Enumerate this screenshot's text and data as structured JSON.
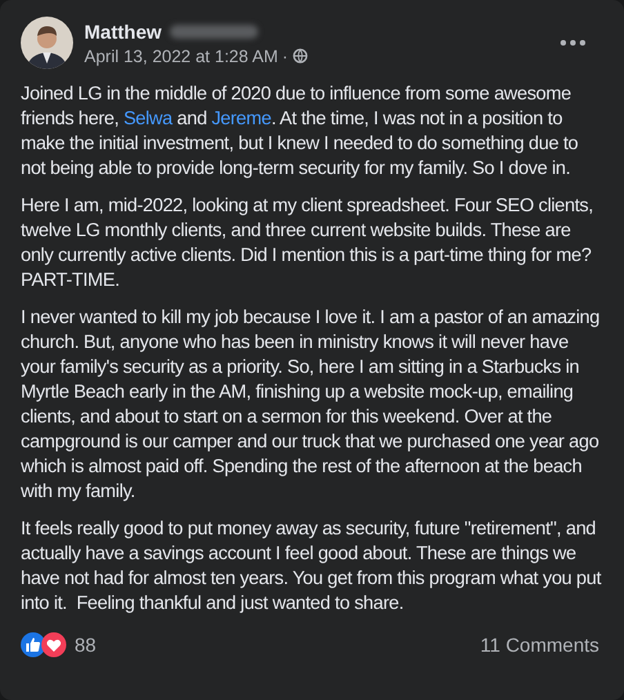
{
  "post": {
    "author": "Matthew",
    "timestamp": "April 13, 2022 at 1:28 AM",
    "separator": "·",
    "paragraphs": [
      [
        {
          "text": "Joined LG in the middle of 2020 due to influence from some awesome friends here, "
        },
        {
          "text": "Selwa",
          "link": true
        },
        {
          "text": " and "
        },
        {
          "text": "Jereme",
          "link": true
        },
        {
          "text": ". At the time, I was not in a position to make the initial investment, but I knew I needed to do something due to not being able to provide long-term security for my family. So I dove in."
        }
      ],
      [
        {
          "text": "Here I am, mid-2022, looking at my client spreadsheet. Four SEO clients, twelve LG monthly clients, and three current website builds. These are only currently active clients. Did I mention this is a part-time thing for me? PART-TIME."
        }
      ],
      [
        {
          "text": "I never wanted to kill my job because I love it. I am a pastor of an amazing church. But, anyone who has been in ministry knows it will never have your family's security as a priority. So, here I am sitting in a Starbucks in Myrtle Beach early in the AM, finishing up a website mock-up, emailing clients, and about to start on a sermon for this weekend. Over at the campground is our camper and our truck that we purchased one year ago which is almost paid off. Spending the rest of the afternoon at the beach with my family."
        }
      ],
      [
        {
          "text": "It feels really good to put money away as security, future \"retirement\", and actually have a savings account I feel good about. These are things we have not had for almost ten years. You get from this program what you put into it.  Feeling thankful and just wanted to share."
        }
      ]
    ],
    "reaction_count": "88",
    "comments": "11 Comments"
  }
}
